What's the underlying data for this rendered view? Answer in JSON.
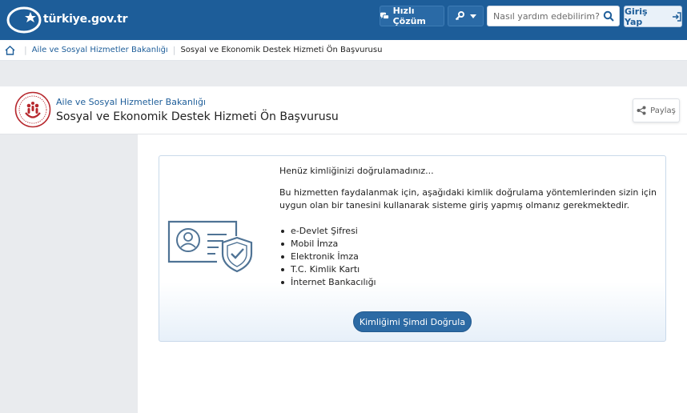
{
  "topbar": {
    "logo_text": "türkiye.gov.tr",
    "quick_solution_label": "Hızlı Çözüm",
    "search_placeholder": "Nasıl yardım edebilirim?",
    "login_label": "Giriş Yap",
    "brand_color": "#1d5d99"
  },
  "breadcrumb": {
    "items": [
      "Aile ve Sosyal Hizmetler Bakanlığı",
      "Sosyal ve Ekonomik Destek Hizmeti Ön Başvurusu"
    ]
  },
  "header": {
    "ministry": "Aile ve Sosyal Hizmetler Bakanlığı",
    "title": "Sosyal ve Ekonomik Destek Hizmeti Ön Başvurusu",
    "share_label": "Paylaş"
  },
  "notice": {
    "title": "Henüz kimliğinizi doğrulamadınız...",
    "body": "Bu hizmetten faydalanmak için, aşağıdaki kimlik doğrulama yöntemlerinden sizin için uygun olan bir tanesini kullanarak sisteme giriş yapmış olmanız gerekmektedir.",
    "methods": [
      "e-Devlet Şifresi",
      "Mobil İmza",
      "Elektronik İmza",
      "T.C. Kimlik Kartı",
      "İnternet Bankacılığı"
    ],
    "verify_button_label": "Kimliğimi Şimdi Doğrula"
  }
}
